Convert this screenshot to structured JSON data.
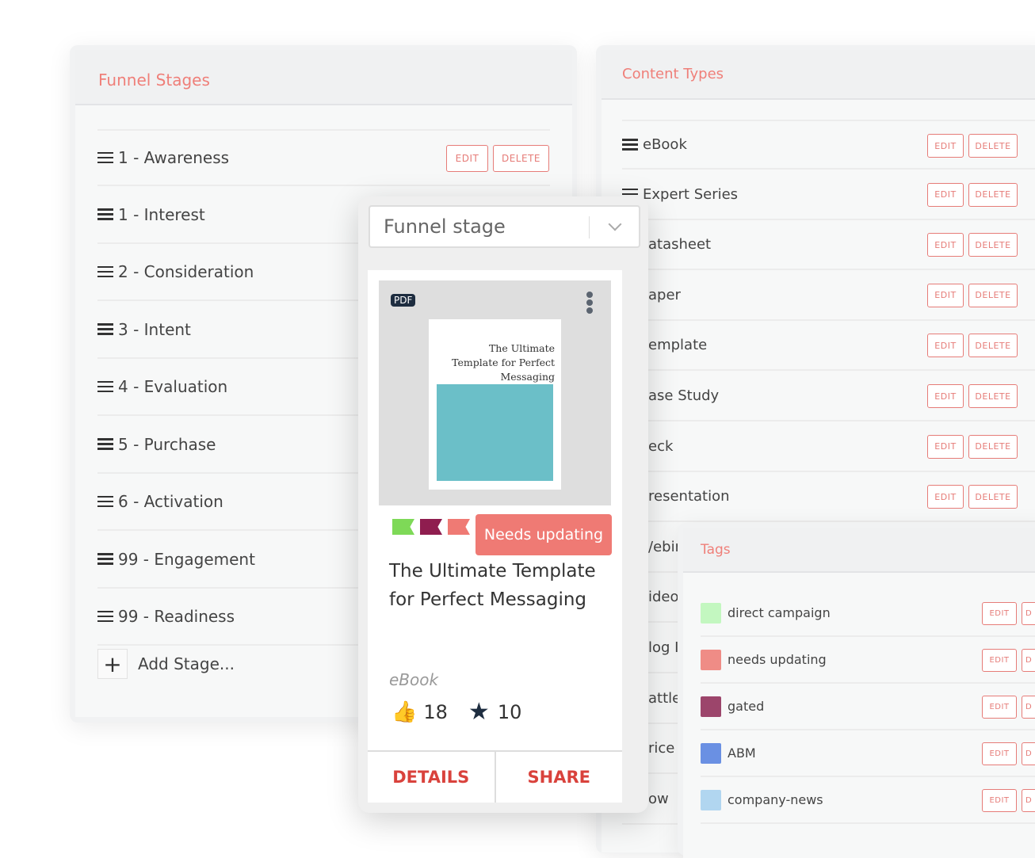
{
  "funnel": {
    "title": "Funnel Stages",
    "stages": [
      "1 - Awareness",
      "1 - Interest",
      "2 - Consideration",
      "3 - Intent",
      "4 - Evaluation",
      "5 - Purchase",
      "6 - Activation",
      "99 - Engagement",
      "99 - Readiness"
    ],
    "add_label": "Add Stage...",
    "edit": "EDIT",
    "delete": "DELETE"
  },
  "content_types": {
    "title": "Content Types",
    "items": [
      "eBook",
      "Expert Series",
      "atasheet",
      "aper",
      "emplate",
      "ase Study",
      "eck",
      "resentation",
      "/ebir",
      "ideo",
      "log I",
      "attle",
      "rice",
      "ow "
    ],
    "edit": "EDIT",
    "delete": "DELETE"
  },
  "tags": {
    "title": "Tags",
    "items": [
      {
        "name": "direct campaign",
        "color": "#c3f7c0"
      },
      {
        "name": "needs updating",
        "color": "#ef8c86"
      },
      {
        "name": "gated",
        "color": "#9c456b"
      },
      {
        "name": "ABM",
        "color": "#6a90e3"
      },
      {
        "name": "company-news",
        "color": "#b1d6f0"
      }
    ],
    "edit": "EDIT",
    "delete": "D"
  },
  "card": {
    "select_placeholder": "Funnel stage",
    "file_badge": "PDF",
    "cover_title": "The Ultimate Template for Perfect Messaging",
    "tag_colors": [
      "#7ed957",
      "#8f1d4f",
      "#ef7a74"
    ],
    "status_badge": "Needs updating",
    "status_color": "#ef7a74",
    "title": "The Ultimate Template for Perfect Messaging",
    "type": "eBook",
    "likes": "18",
    "stars": "10",
    "details": "DETAILS",
    "share": "SHARE"
  }
}
